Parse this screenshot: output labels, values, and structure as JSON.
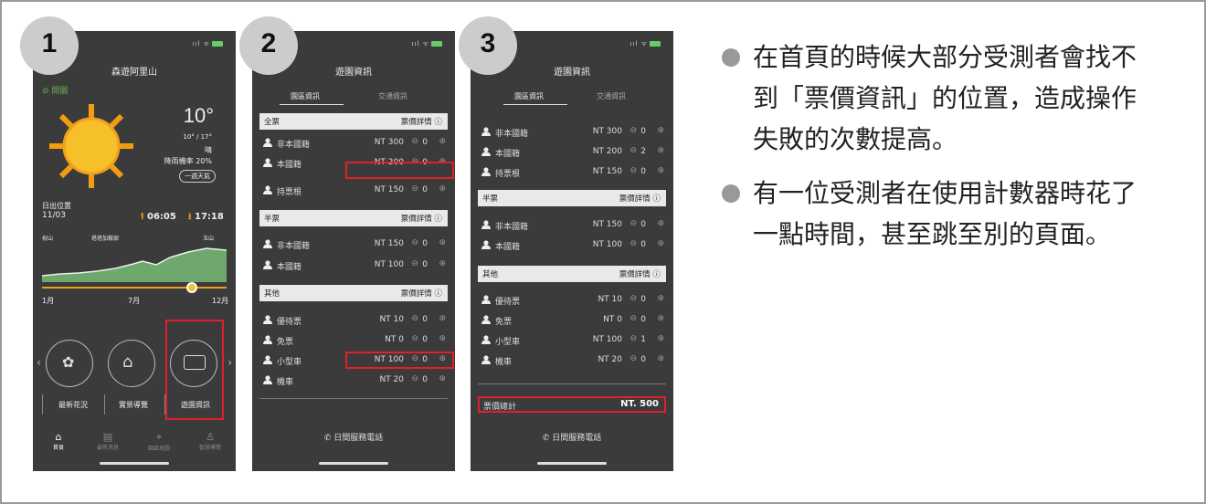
{
  "badges": [
    "1",
    "2",
    "3"
  ],
  "status_bar": "ııl ᯤ",
  "p1": {
    "title": "森遊阿里山",
    "open_status": "開園",
    "temp": "10°",
    "range": "10° / 17°",
    "weather": "晴",
    "rain": "降雨機率 20%",
    "week_button": "一週天氣",
    "sunrise_label": "日出位置",
    "date": "11/03",
    "sunrise_time": "06:05",
    "sunset_time": "17:18",
    "mountains": [
      "祝山",
      "塔塔加鞍部",
      "玉山"
    ],
    "months": [
      "1月",
      "7月",
      "12月"
    ],
    "menu": [
      "最新花況",
      "實景導覽",
      "遊園資訊"
    ],
    "nav": [
      "首頁",
      "最新消息",
      "園區地圖",
      "智慧導覽"
    ]
  },
  "tabs": {
    "park": "園區資訊",
    "traffic": "交通資訊"
  },
  "detail_label": "票價詳情 ⓘ",
  "p2": {
    "sections": [
      {
        "title": "全票",
        "rows": [
          {
            "name": "非本國籍",
            "price": "NT 300",
            "qty": "0"
          },
          {
            "name": "本國籍",
            "price": "NT 200",
            "qty": "0"
          },
          {
            "name": "持票根",
            "price": "NT 150",
            "qty": "0"
          }
        ]
      },
      {
        "title": "半票",
        "rows": [
          {
            "name": "非本國籍",
            "price": "NT 150",
            "qty": "0"
          },
          {
            "name": "本國籍",
            "price": "NT 100",
            "qty": "0"
          }
        ]
      },
      {
        "title": "其他",
        "rows": [
          {
            "name": "優待票",
            "price": "NT 10",
            "qty": "0"
          },
          {
            "name": "免票",
            "price": "NT 0",
            "qty": "0"
          },
          {
            "name": "小型車",
            "price": "NT 100",
            "qty": "0"
          },
          {
            "name": "機車",
            "price": "NT 20",
            "qty": "0"
          }
        ]
      }
    ]
  },
  "p3": {
    "top_rows": [
      {
        "name": "非本國籍",
        "price": "NT 300",
        "qty": "0"
      },
      {
        "name": "本國籍",
        "price": "NT 200",
        "qty": "2"
      },
      {
        "name": "持票根",
        "price": "NT 150",
        "qty": "0"
      }
    ],
    "sections": [
      {
        "title": "半票",
        "rows": [
          {
            "name": "非本國籍",
            "price": "NT 150",
            "qty": "0"
          },
          {
            "name": "本國籍",
            "price": "NT 100",
            "qty": "0"
          }
        ]
      },
      {
        "title": "其他",
        "rows": [
          {
            "name": "優待票",
            "price": "NT 10",
            "qty": "0"
          },
          {
            "name": "免票",
            "price": "NT 0",
            "qty": "0"
          },
          {
            "name": "小型車",
            "price": "NT 100",
            "qty": "1"
          },
          {
            "name": "機車",
            "price": "NT 20",
            "qty": "0"
          }
        ]
      }
    ],
    "total_label": "票價總計",
    "total_value": "NT. 500"
  },
  "service_phone": "日間服務電話",
  "notes": [
    "在首頁的時候大部分受測者會找不到「票價資訊」的位置，造成操作失敗的次數提高。",
    "有一位受測者在使用計數器時花了一點時間，甚至跳至別的頁面。"
  ]
}
